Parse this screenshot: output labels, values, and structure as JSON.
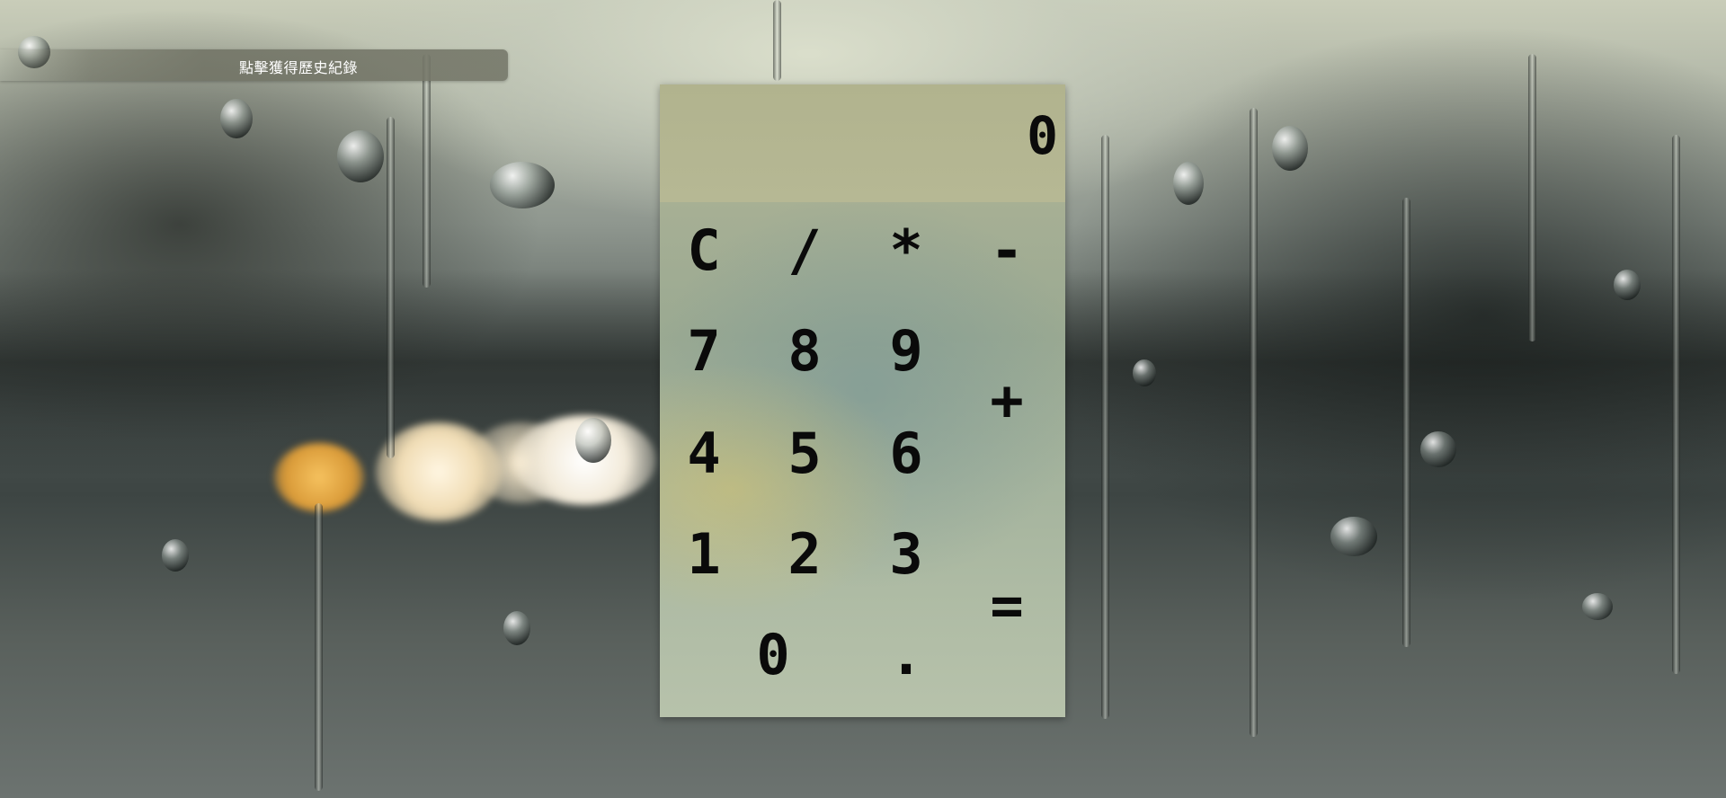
{
  "history": {
    "label": "點擊獲得歷史紀錄"
  },
  "calculator": {
    "display": "0",
    "keys": {
      "clear": "C",
      "divide": "/",
      "multiply": "*",
      "subtract": "-",
      "seven": "7",
      "eight": "8",
      "nine": "9",
      "add": "+",
      "four": "4",
      "five": "5",
      "six": "6",
      "one": "1",
      "two": "2",
      "three": "3",
      "equals": "=",
      "zero": "0",
      "decimal": "."
    }
  }
}
